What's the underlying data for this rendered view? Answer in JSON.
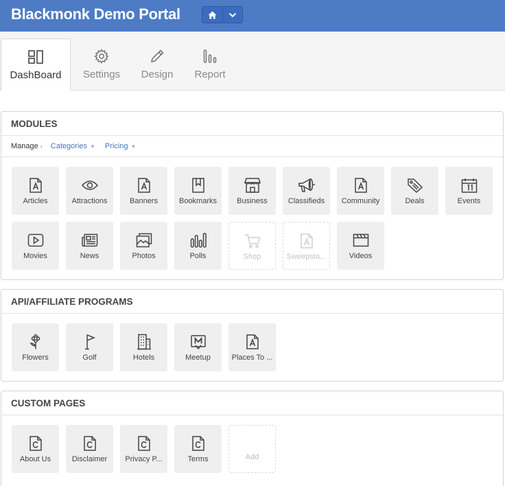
{
  "header": {
    "title": "Blackmonk Demo Portal"
  },
  "tabs": [
    {
      "label": "DashBoard",
      "icon": "dashboard-icon"
    },
    {
      "label": "Settings",
      "icon": "gear-icon"
    },
    {
      "label": "Design",
      "icon": "pencil-icon"
    },
    {
      "label": "Report",
      "icon": "bar-chart-icon"
    }
  ],
  "modules": {
    "title": "MODULES",
    "subnav": {
      "manage": "Manage",
      "categories": "Categories",
      "pricing": "Pricing"
    },
    "items": [
      {
        "label": "Articles",
        "icon": "document-icon"
      },
      {
        "label": "Attractions",
        "icon": "eye-icon"
      },
      {
        "label": "Banners",
        "icon": "document-icon"
      },
      {
        "label": "Bookmarks",
        "icon": "bookmark-icon"
      },
      {
        "label": "Business",
        "icon": "store-icon"
      },
      {
        "label": "Classifieds",
        "icon": "megaphone-icon"
      },
      {
        "label": "Community",
        "icon": "document-icon"
      },
      {
        "label": "Deals",
        "icon": "tag-icon"
      },
      {
        "label": "Events",
        "icon": "calendar-icon"
      },
      {
        "label": "Movies",
        "icon": "play-icon"
      },
      {
        "label": "News",
        "icon": "newspaper-icon"
      },
      {
        "label": "Photos",
        "icon": "photos-icon"
      },
      {
        "label": "Polls",
        "icon": "bar-chart-icon"
      },
      {
        "label": "Shop",
        "icon": "cart-icon"
      },
      {
        "label": "Sweepsta...",
        "icon": "document-icon"
      },
      {
        "label": "Videos",
        "icon": "clapperboard-icon"
      }
    ]
  },
  "api": {
    "title": "API/AFFILIATE PROGRAMS",
    "items": [
      {
        "label": "Flowers",
        "icon": "flower-icon"
      },
      {
        "label": "Golf",
        "icon": "flag-icon"
      },
      {
        "label": "Hotels",
        "icon": "building-icon"
      },
      {
        "label": "Meetup",
        "icon": "meetup-icon"
      },
      {
        "label": "Places To ...",
        "icon": "document-icon"
      }
    ]
  },
  "custom": {
    "title": "CUSTOM PAGES",
    "items": [
      {
        "label": "About Us",
        "icon": "page-c-icon"
      },
      {
        "label": "Disclaimer",
        "icon": "page-c-icon"
      },
      {
        "label": "Privacy P...",
        "icon": "page-c-icon"
      },
      {
        "label": "Terms",
        "icon": "page-c-icon"
      }
    ],
    "add_label": "Add"
  },
  "colors": {
    "header": "#4d7cc4",
    "link": "#4a76b0",
    "tile": "#efefef"
  }
}
